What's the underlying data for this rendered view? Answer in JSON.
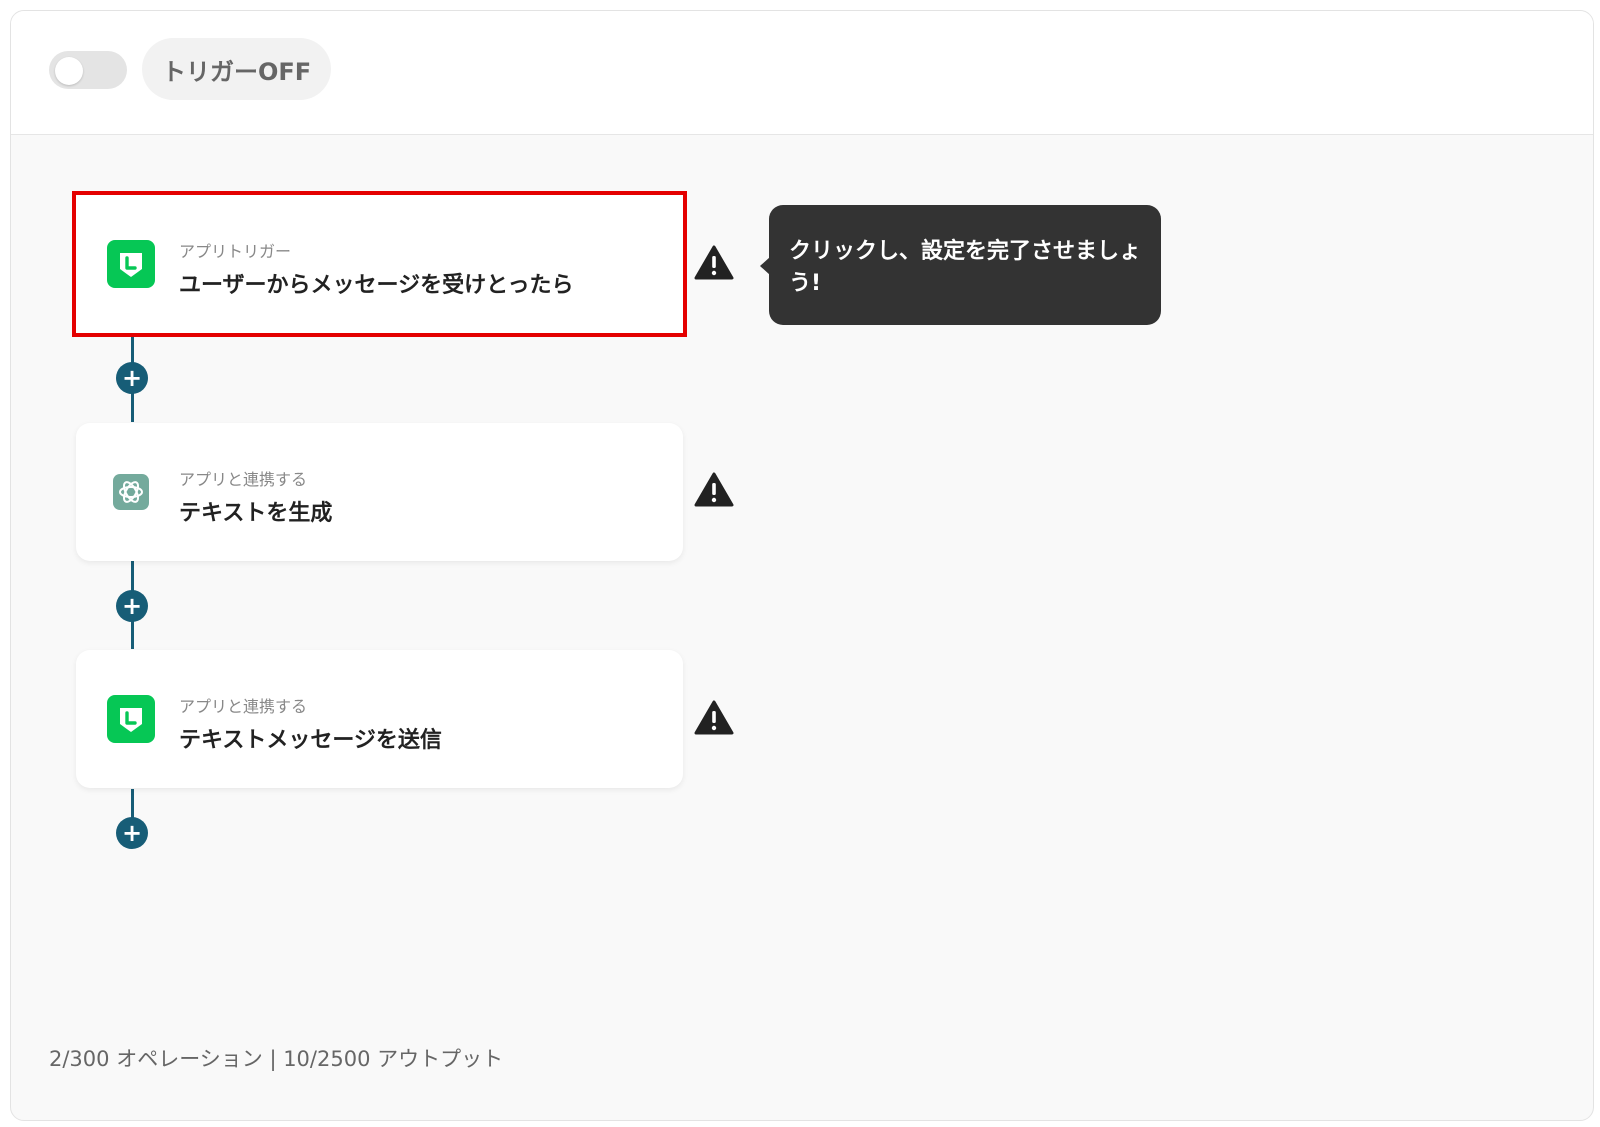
{
  "header": {
    "trigger_label": "トリガーOFF",
    "toggle_state": "off"
  },
  "flow": {
    "steps": [
      {
        "subtitle": "アプリトリガー",
        "title": "ユーザーからメッセージを受けとったら",
        "app_icon": "line-icon",
        "status_icon": "warning-icon",
        "selected": true
      },
      {
        "subtitle": "アプリと連携する",
        "title": "テキストを生成",
        "app_icon": "chatgpt-icon",
        "status_icon": "warning-icon",
        "selected": false
      },
      {
        "subtitle": "アプリと連携する",
        "title": "テキストメッセージを送信",
        "app_icon": "line-icon",
        "status_icon": "warning-icon",
        "selected": false
      }
    ],
    "add_step_symbol": "+"
  },
  "tooltip": {
    "text": "クリックし、設定を完了させましょう!"
  },
  "usage": {
    "text": "2/300 オペレーション | 10/2500 アウトプット"
  },
  "colors": {
    "accent": "#175d77",
    "selected_outline": "#e40000",
    "line_green": "#06c755",
    "chatgpt_green": "#74aa9c",
    "tooltip_bg": "#333333"
  }
}
